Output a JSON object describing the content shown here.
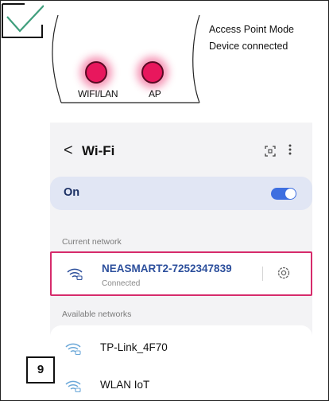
{
  "device": {
    "leds": [
      {
        "label": "WIFI/LAN",
        "color": "#e8175d"
      },
      {
        "label": "AP",
        "color": "#e8175d"
      }
    ],
    "status_lines": [
      "Access Point Mode",
      "Device connected"
    ],
    "status_icon": "checkmark-icon"
  },
  "phone": {
    "back_glyph": "<",
    "title": "Wi-Fi",
    "scan_icon": "qr-scan-icon",
    "more_icon": "more-vertical-icon",
    "wifi_switch": {
      "label": "On",
      "enabled": true
    },
    "current_section": "Current network",
    "current_network": {
      "name": "NEASMART2-7252347839",
      "status": "Connected"
    },
    "available_section": "Available networks",
    "available_networks": [
      {
        "name": "TP-Link_4F70"
      },
      {
        "name": "WLAN IoT"
      }
    ]
  },
  "step_badge": "9",
  "colors": {
    "highlight": "#d62b6b",
    "accent": "#3e6fe0",
    "led": "#e8175d"
  }
}
